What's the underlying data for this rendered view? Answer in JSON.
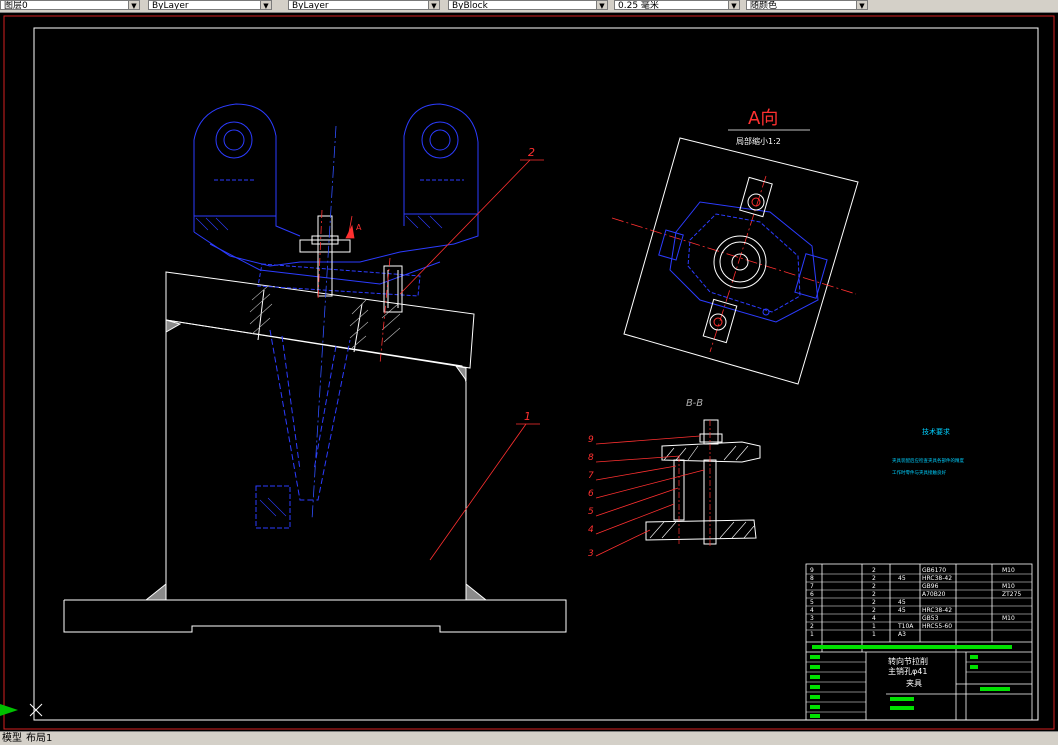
{
  "toolbar": {
    "combos": [
      {
        "value": "图层0",
        "name": "layer-combo"
      },
      {
        "value": "ByLayer",
        "name": "color-combo"
      },
      {
        "value": "ByLayer",
        "name": "linetype-combo"
      },
      {
        "value": "ByBlock",
        "name": "lineweight-combo"
      },
      {
        "value": "0.25 毫米",
        "name": "linewidth-combo"
      },
      {
        "value": "随颜色",
        "name": "plotstyle-combo"
      }
    ]
  },
  "drawing": {
    "view_a_title": "A向",
    "view_a_subtitle": "局部缩小1:2",
    "view_arrow_label": "A",
    "section_title": "B-B",
    "leader_main_2": "2",
    "leader_main_1": "1",
    "balloons": [
      "9",
      "8",
      "7",
      "6",
      "5",
      "4",
      "3"
    ],
    "tech_title": "技术要求",
    "tech_line1": "夹具装配后应检查夹具各部件的精度",
    "tech_line2": "工作时零件与夹具接触良好"
  },
  "title_block": {
    "part_name_1": "转向节拉削",
    "part_name_2": "主销孔φ41",
    "part_name_3": "夹具",
    "rows": [
      {
        "no": "9",
        "qty": "2",
        "mat": "",
        "std": "GB6170",
        "note": "M10"
      },
      {
        "no": "8",
        "qty": "2",
        "mat": "45",
        "std": "HRC38-42",
        "note": ""
      },
      {
        "no": "7",
        "qty": "2",
        "mat": "",
        "std": "GB96",
        "note": "M10"
      },
      {
        "no": "6",
        "qty": "2",
        "mat": "",
        "std": "A70B20",
        "note": "ZT275"
      },
      {
        "no": "5",
        "qty": "2",
        "mat": "45",
        "std": "",
        "note": ""
      },
      {
        "no": "4",
        "qty": "2",
        "mat": "45",
        "std": "HRC38-42",
        "note": ""
      },
      {
        "no": "3",
        "qty": "4",
        "mat": "",
        "std": "GB53",
        "note": "M10"
      },
      {
        "no": "2",
        "qty": "1",
        "mat": "T10A",
        "std": "HRC55-60",
        "note": ""
      },
      {
        "no": "1",
        "qty": "1",
        "mat": "A3",
        "std": "",
        "note": ""
      }
    ]
  },
  "status": {
    "model_tab": "模型",
    "layout_tab": "布局1"
  }
}
